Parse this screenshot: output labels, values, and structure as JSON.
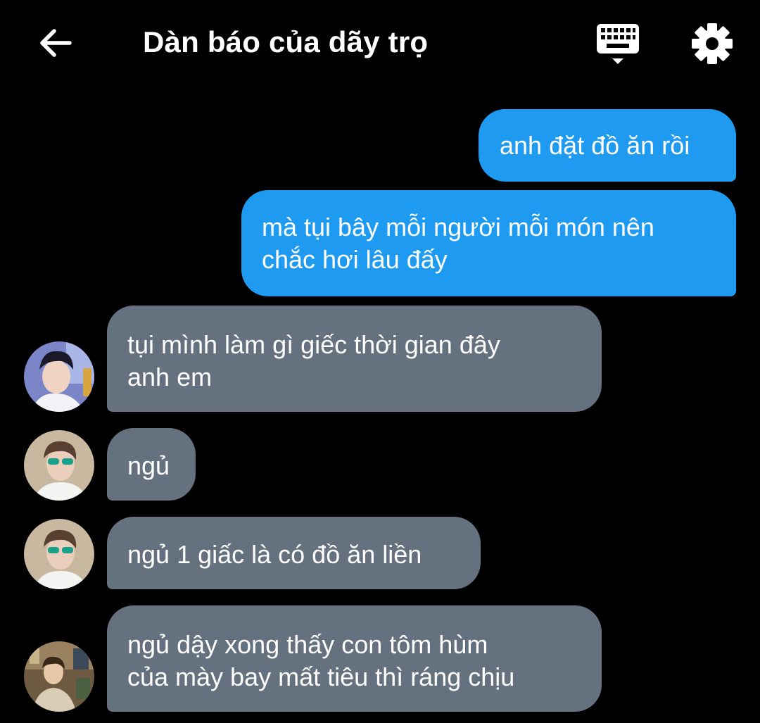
{
  "header": {
    "title": "Dàn báo của dãy trọ",
    "back_icon": "arrow-left-icon",
    "keyboard_icon": "keyboard-icon",
    "settings_icon": "gear-icon"
  },
  "colors": {
    "background": "#000000",
    "outgoing_bubble": "#1e9bf0",
    "incoming_bubble": "#65717f",
    "text": "#ffffff"
  },
  "messages": [
    {
      "direction": "outgoing",
      "text": "anh đặt đồ ăn rồi"
    },
    {
      "direction": "outgoing",
      "text": "mà tụi bây mỗi người mỗi món nên\nchắc hơi lâu đấy"
    },
    {
      "direction": "incoming",
      "avatar": "avatar-1",
      "text": "tụi mình làm gì giếc thời gian đây\nanh em"
    },
    {
      "direction": "incoming",
      "avatar": "avatar-2",
      "text": "ngủ"
    },
    {
      "direction": "incoming",
      "avatar": "avatar-2",
      "text": "ngủ 1 giấc là có đồ ăn liền"
    },
    {
      "direction": "incoming",
      "avatar": "avatar-3",
      "text": "ngủ dậy xong thấy con tôm hùm\ncủa mày bay mất tiêu thì ráng chịu"
    }
  ]
}
